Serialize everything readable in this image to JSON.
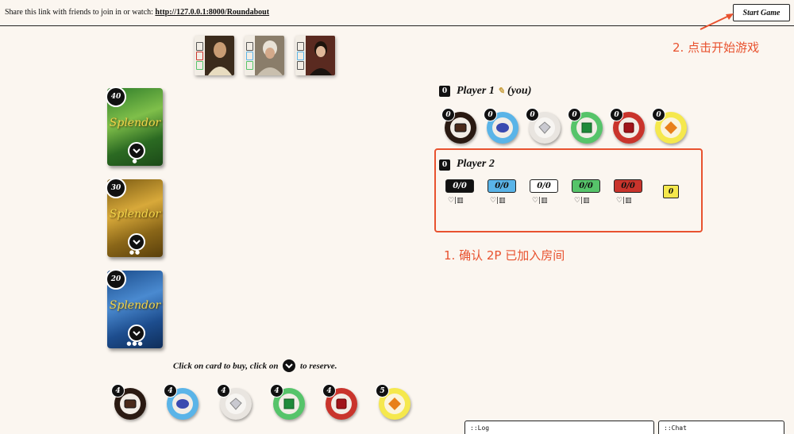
{
  "header": {
    "share_text": "Share this link with friends to join in or watch:",
    "share_link": "http://127.0.0.1:8000/Roundabout",
    "start_button": "Start Game"
  },
  "annotations": {
    "step2": "2. 点击开始游戏",
    "step1": "1. 确认 2P 已加入房间"
  },
  "nobles": [
    {
      "name": "noble-1"
    },
    {
      "name": "noble-2"
    },
    {
      "name": "noble-3"
    }
  ],
  "decks": [
    {
      "count": "40",
      "title": "Splendor",
      "dots": "●",
      "color": "green"
    },
    {
      "count": "30",
      "title": "Splendor",
      "dots": "●●",
      "color": "gold"
    },
    {
      "count": "20",
      "title": "Splendor",
      "dots": "●●●",
      "color": "blue"
    }
  ],
  "instructions": {
    "before": "Click on card to buy, click on",
    "after": "to reserve."
  },
  "bank": [
    {
      "gem": "onyx",
      "count": "4"
    },
    {
      "gem": "sapphire",
      "count": "4"
    },
    {
      "gem": "diamond",
      "count": "4"
    },
    {
      "gem": "emerald",
      "count": "4"
    },
    {
      "gem": "ruby",
      "count": "4"
    },
    {
      "gem": "gold",
      "count": "5"
    }
  ],
  "player1": {
    "score": "0",
    "name": "Player 1",
    "edit_icon": "✎",
    "you": "(you)",
    "tokens": [
      {
        "gem": "onyx",
        "count": "0"
      },
      {
        "gem": "sapphire",
        "count": "0"
      },
      {
        "gem": "diamond",
        "count": "0"
      },
      {
        "gem": "emerald",
        "count": "0"
      },
      {
        "gem": "ruby",
        "count": "0"
      },
      {
        "gem": "gold",
        "count": "0"
      }
    ]
  },
  "player2": {
    "score": "0",
    "name": "Player 2",
    "gems": [
      {
        "gem": "onyx",
        "value": "0/0",
        "sub": "♡|▥"
      },
      {
        "gem": "sapphire",
        "value": "0/0",
        "sub": "♡|▥"
      },
      {
        "gem": "diamond",
        "value": "0/0",
        "sub": "♡|▥"
      },
      {
        "gem": "emerald",
        "value": "0/0",
        "sub": "♡|▥"
      },
      {
        "gem": "ruby",
        "value": "0/0",
        "sub": "♡|▥"
      }
    ],
    "gold": "0"
  },
  "panels": {
    "log": "::Log",
    "chat": "::Chat"
  },
  "colors": {
    "accent": "#e8522f",
    "onyx": "#111111",
    "sapphire": "#5ab4e8",
    "diamond": "#ffffff",
    "emerald": "#56c46a",
    "ruby": "#c9342c",
    "gold": "#f5e84d"
  }
}
